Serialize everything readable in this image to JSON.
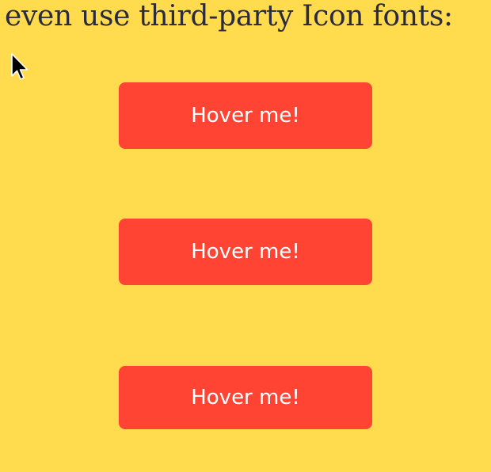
{
  "heading": {
    "text": "even use third-party Icon fonts:"
  },
  "cursor": {
    "icon": "mouse-pointer-icon"
  },
  "buttons": [
    {
      "label": "Hover me!"
    },
    {
      "label": "Hover me!"
    },
    {
      "label": "Hover me!"
    }
  ],
  "colors": {
    "background": "#ffdb4d",
    "button": "#ff4433",
    "button_text": "#ffffff",
    "heading_text": "#2b2b3f"
  }
}
